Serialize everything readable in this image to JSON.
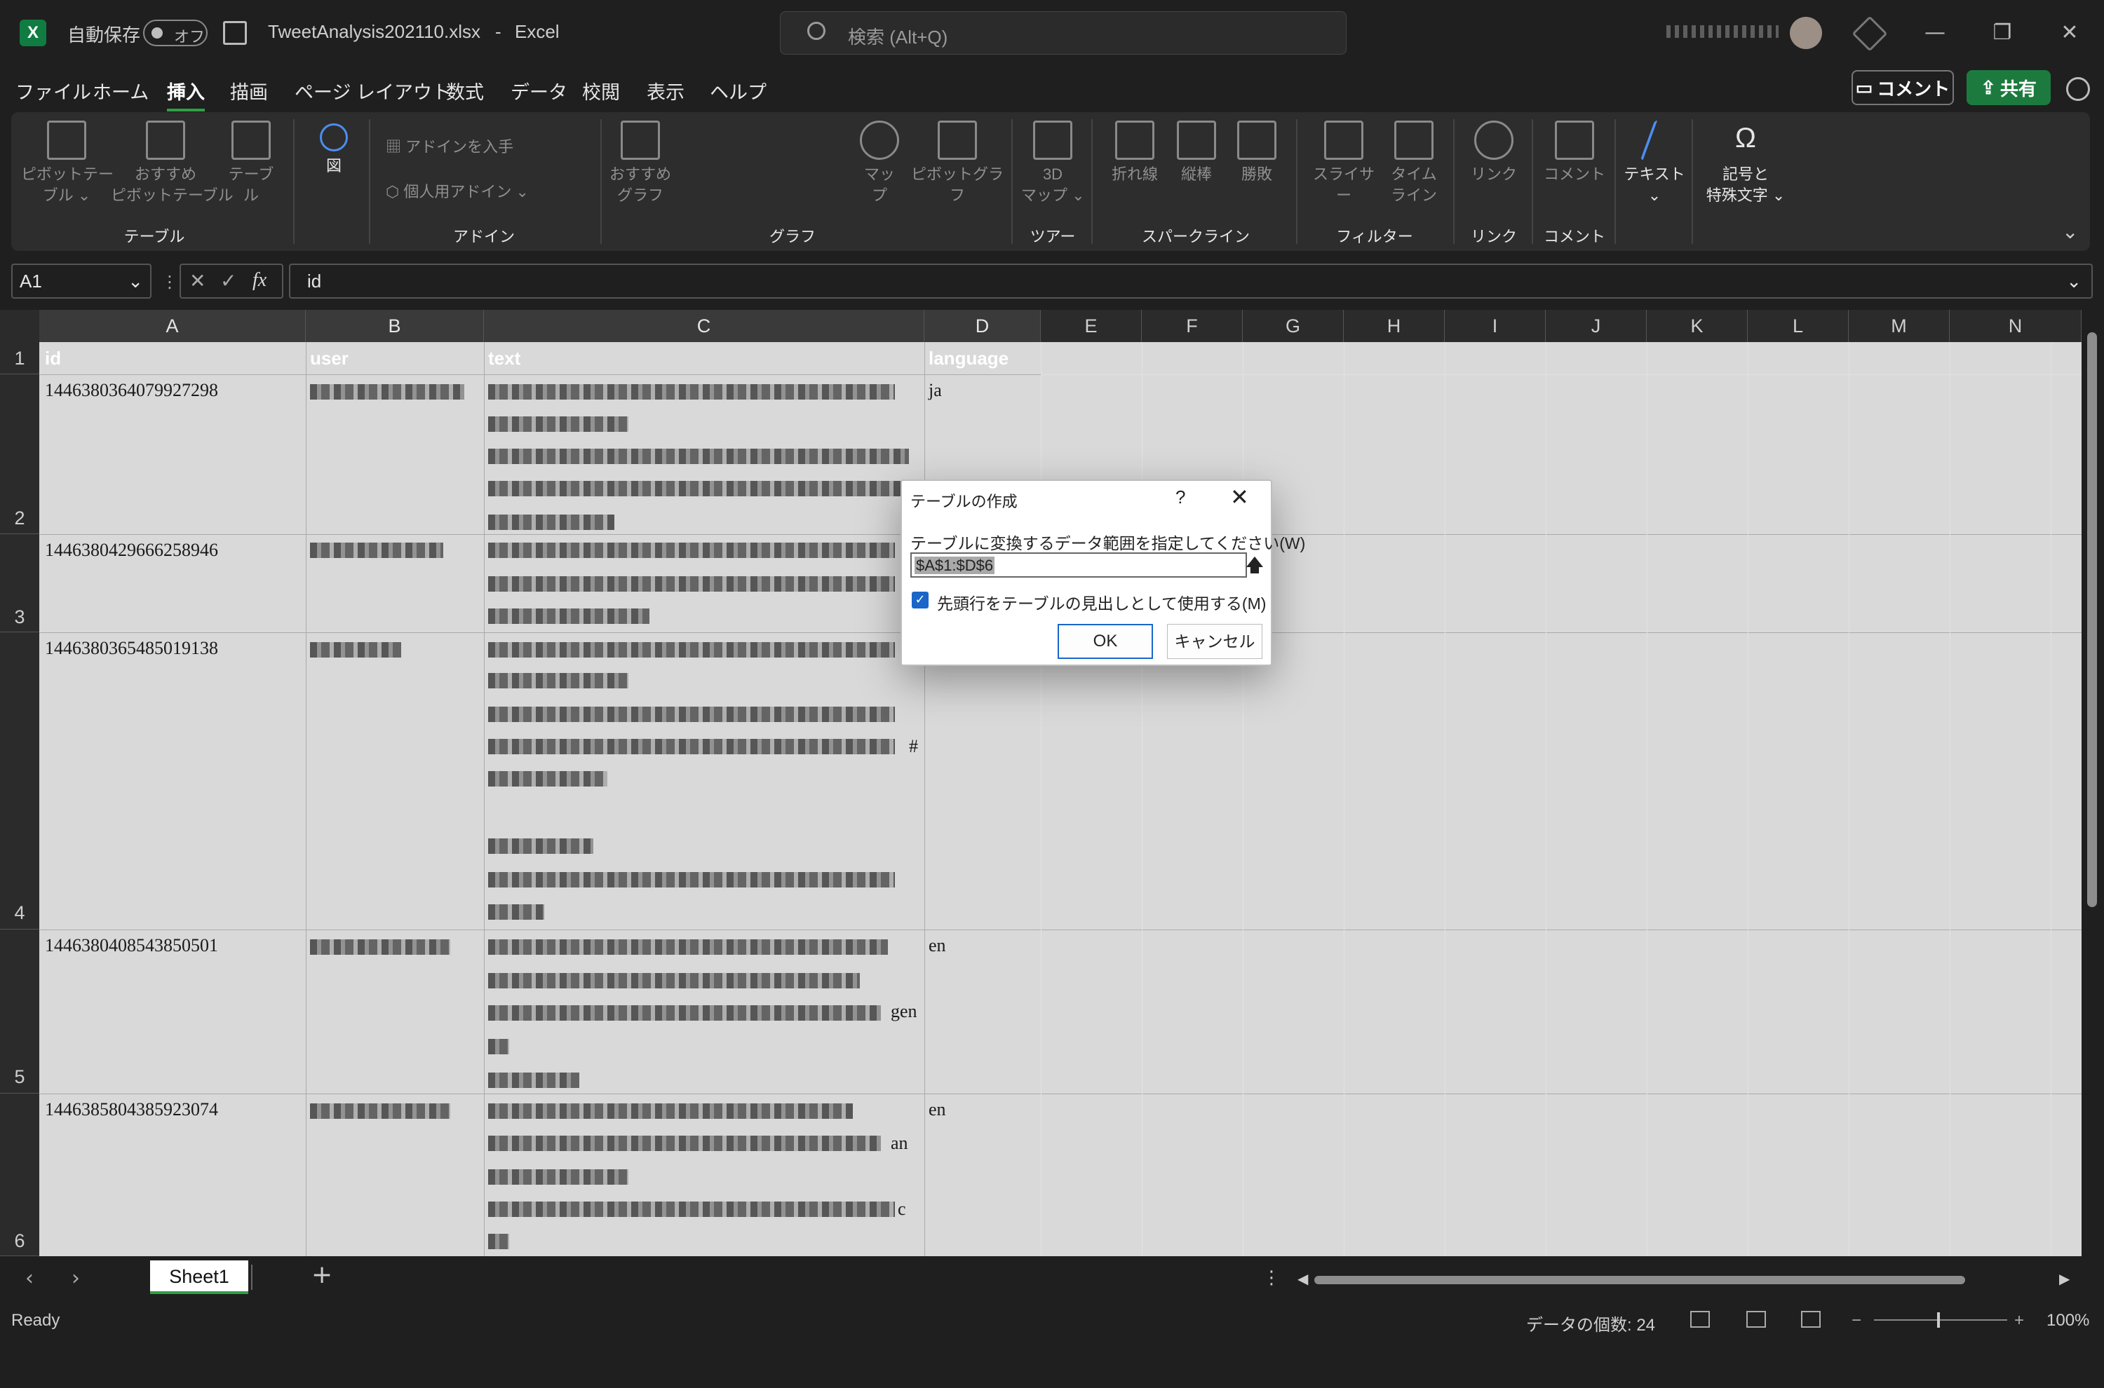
{
  "titlebar": {
    "autosave_label": "自動保存",
    "autosave_state": "オフ",
    "filename": "TweetAnalysis202110.xlsx",
    "separator": "-",
    "app": "Excel",
    "search_placeholder": "検索 (Alt+Q)",
    "minimize": "—",
    "restore": "❐",
    "close": "✕"
  },
  "menu": {
    "items": [
      "ファイル",
      "ホーム",
      "挿入",
      "描画",
      "ページ レイアウト",
      "数式",
      "データ",
      "校閲",
      "表示",
      "ヘルプ"
    ],
    "active": "挿入",
    "comment_button": "コメント",
    "share_button": "共有"
  },
  "ribbon": {
    "pivot_table": "ピボットテー\nブル ⌄",
    "recommended_pivot": "おすすめ\nピボットテーブル",
    "table": "テーブル",
    "group_table": "テーブル",
    "figure": "図",
    "get_addin": "アドインを入手",
    "my_addin": "個人用アドイン",
    "group_addin": "アドイン",
    "recommended_charts": "おすすめ\nグラフ",
    "map": "マップ",
    "pivot_chart": "ピボットグラフ",
    "group_chart": "グラフ",
    "map3d": "3D\nマップ ⌄",
    "group_tour": "ツアー",
    "line": "折れ線",
    "column": "縦棒",
    "winloss": "勝敗",
    "group_sparkline": "スパークライン",
    "slicer": "スライサー",
    "timeline": "タイム\nライン",
    "group_filter": "フィルター",
    "link": "リンク",
    "group_link": "リンク",
    "comment": "コメント",
    "group_comment": "コメント",
    "text": "テキスト",
    "symbols": "記号と\n特殊文字 ⌄"
  },
  "formula_bar": {
    "name_box": "A1",
    "formula": "id"
  },
  "columns": [
    "A",
    "B",
    "C",
    "D",
    "E",
    "F",
    "G",
    "H",
    "I",
    "J",
    "K",
    "L",
    "M",
    "N"
  ],
  "rows": [
    "1",
    "2",
    "3",
    "4",
    "5",
    "6"
  ],
  "table": {
    "headers": [
      "id",
      "user",
      "text",
      "language"
    ],
    "rows": [
      {
        "id": "1446380364079927298",
        "lang": "ja"
      },
      {
        "id": "1446380429666258946",
        "lang": ""
      },
      {
        "id": "1446380365485019138",
        "lang": ""
      },
      {
        "id": "1446380408543850501",
        "lang": "en"
      },
      {
        "id": "1446385804385923074",
        "lang": "en"
      }
    ],
    "text_fragments": {
      "r5_gen": "gen",
      "r6_an": "an",
      "r6_c": "c",
      "r4_hash": "#"
    }
  },
  "dialog": {
    "title": "テーブルの作成",
    "help": "?",
    "close": "✕",
    "prompt": "テーブルに変換するデータ範囲を指定してください(W)",
    "range": "$A$1:$D$6",
    "checkbox_label": "先頭行をテーブルの見出しとして使用する(M)",
    "checkbox_checked": true,
    "ok": "OK",
    "cancel": "キャンセル"
  },
  "sheets": {
    "tabs": [
      "Sheet1"
    ],
    "add": "+"
  },
  "status": {
    "ready": "Ready",
    "count": "データの個数: 24",
    "zoom": "100%"
  },
  "colors": {
    "accent_green": "#2ea043",
    "excel_green": "#107c41",
    "dialog_blue": "#1a66c9"
  }
}
